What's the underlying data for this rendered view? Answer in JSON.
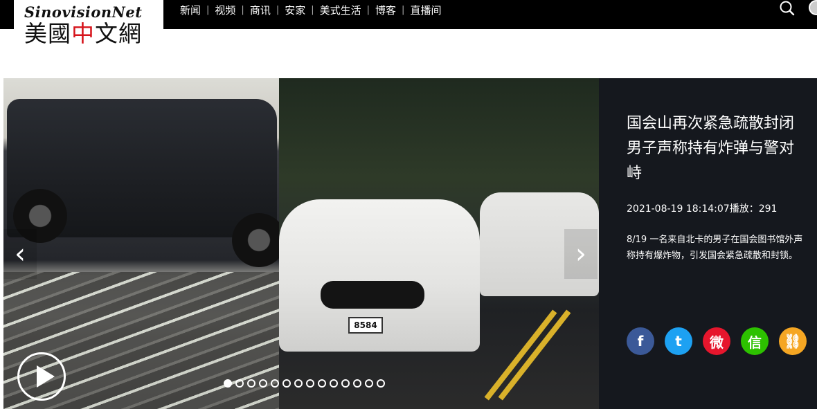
{
  "logo": {
    "en": "SinovisionNet",
    "cn_pre": "美國",
    "cn_red": "中",
    "cn_post": "文網"
  },
  "nav": [
    "新闻",
    "视频",
    "商讯",
    "安家",
    "美式生活",
    "博客",
    "直播间"
  ],
  "nav_separator": "|",
  "icons": {
    "search": "search-icon",
    "avatar": "user-avatar"
  },
  "slider": {
    "prev": "‹",
    "next": "›",
    "dots_total": 14,
    "active_dot": 0,
    "plate": "8584"
  },
  "article": {
    "headline": "国会山再次紧急疏散封闭 男子声称持有炸弹与警对峙",
    "meta": "2021-08-19 18:14:07播放：291",
    "summary": "8/19 一名来自北卡的男子在国会图书馆外声称持有爆炸物，引发国会紧急疏散和封锁。"
  },
  "share": [
    {
      "name": "facebook",
      "glyph": "f",
      "color": "#3b5998"
    },
    {
      "name": "twitter",
      "glyph": "t",
      "color": "#1da1f2"
    },
    {
      "name": "weibo",
      "glyph": "微",
      "color": "#e6162d"
    },
    {
      "name": "wechat",
      "glyph": "信",
      "color": "#2dc100"
    },
    {
      "name": "link",
      "glyph": "⛓",
      "color": "#f5a623"
    }
  ]
}
